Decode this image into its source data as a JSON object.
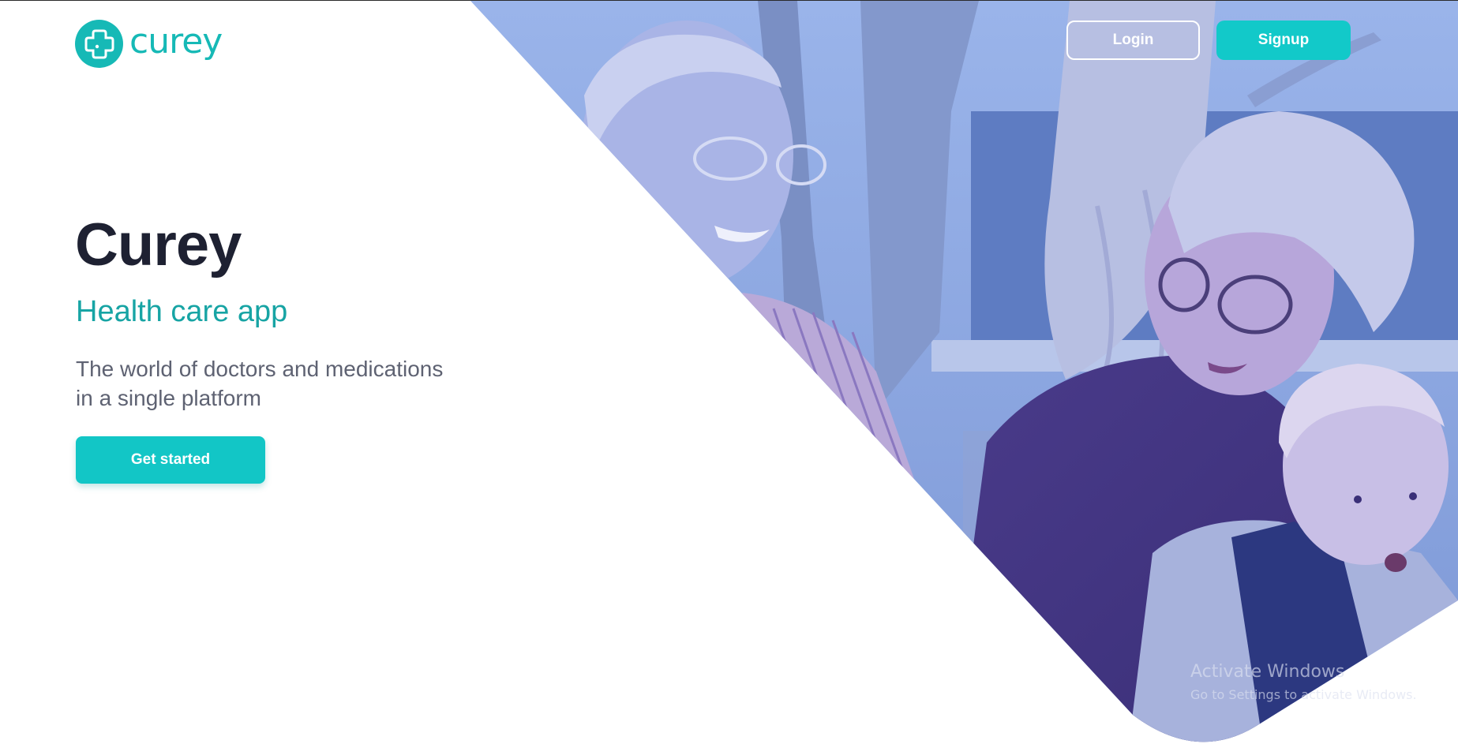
{
  "brand": {
    "name": "curey",
    "color": "#16b9b6",
    "logo_icon": "medical-cross-icon"
  },
  "nav": {
    "login_label": "Login",
    "signup_label": "Signup"
  },
  "hero": {
    "title": "Curey",
    "subtitle": "Health care app",
    "description_line1": "The world of doctors and medications",
    "description_line2": "in a single platform",
    "cta_label": "Get started",
    "photo_overlay_color": "#6a8fd8"
  },
  "watermark": {
    "title": "Activate Windows",
    "subtitle": "Go to Settings to activate Windows."
  },
  "colors": {
    "accent": "#12c9c9",
    "title": "#1e2132",
    "subtitle": "#17a4a4",
    "body_text": "#5e6272"
  }
}
